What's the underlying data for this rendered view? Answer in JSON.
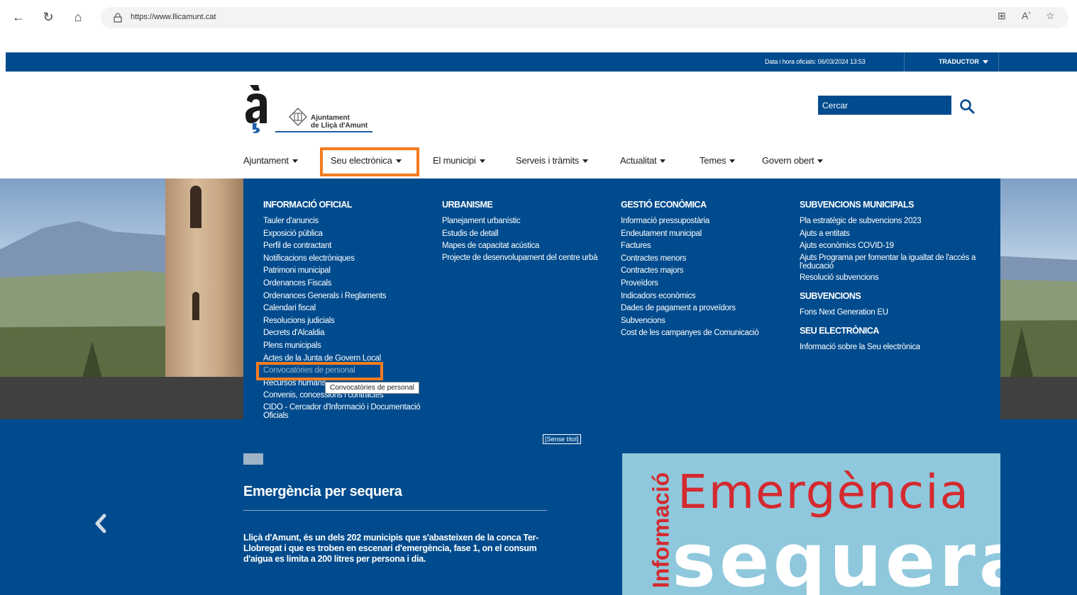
{
  "browser": {
    "url": "https://www.llicamunt.cat"
  },
  "topbar": {
    "date_text": "Data i hora oficials: 06/03/2024 13:53",
    "translator_label": "TRADUCTOR"
  },
  "logo": {
    "line1": "Ajuntament",
    "line2": "de Lliçà d'Amunt"
  },
  "search": {
    "placeholder": "Cercar"
  },
  "nav": {
    "items": [
      {
        "label": "Ajuntament"
      },
      {
        "label": "Seu electrònica"
      },
      {
        "label": "El municipi"
      },
      {
        "label": "Serveis i tràmits"
      },
      {
        "label": "Actualitat"
      },
      {
        "label": "Temes"
      },
      {
        "label": "Govern obert"
      }
    ]
  },
  "megamenu": {
    "col1": {
      "heading": "INFORMACIÓ OFICIAL",
      "items": [
        "Tauler d'anuncis",
        "Exposició pública",
        "Perfil de contractant",
        "Notificacions electròniques",
        "Patrimoni municipal",
        "Ordenances Fiscals",
        "Ordenances Generals i Reglaments",
        "Calendari fiscal",
        "Resolucions judicials",
        "Decrets d'Alcaldia",
        "Plens municipals",
        "Actes de la Junta de Govern Local",
        "Convocatòries de personal",
        "Recursos humans",
        "Convenis, concessions i contractes",
        "CIDO - Cercador d'Informació i Documentació Oficials"
      ]
    },
    "col2": {
      "heading": "URBANISME",
      "items": [
        "Planejament urbanístic",
        "Estudis de detall",
        "Mapes de capacitat acústica",
        "Projecte de desenvolupament del centre urbà"
      ]
    },
    "col3": {
      "heading": "GESTIÓ ECONÒMICA",
      "items": [
        "Informació pressupostària",
        "Endeutament municipal",
        "Factures",
        "Contractes menors",
        "Contractes majors",
        "Proveïdors",
        "Indicadors econòmics",
        "Dades de pagament a proveïdors",
        "Subvencions",
        "Cost de les campanyes de Comunicació"
      ]
    },
    "col4": {
      "heading": "SUBVENCIONS MUNICIPALS",
      "items": [
        "Pla estratègic de subvencions 2023",
        "Ajuts a entitats",
        "Ajuts econòmics COVID-19",
        "Ajuts Programa per fomentar la igualtat de l'accés a l'educació",
        "Resolució subvencions"
      ],
      "heading2": "SUBVENCIONS",
      "items2": [
        "Fons Next Generation EU"
      ],
      "heading3": "SEU ELECTRÒNICA",
      "items3": [
        "Informació sobre la Seu electrònica"
      ]
    },
    "footer_label": "[Sense títol]",
    "tooltip": "Convocatòries de personal"
  },
  "slide": {
    "title": "Emergència per sequera",
    "description": "Lliçà d'Amunt, és un dels 202 municipis que s'abasteixen de la conca Ter-Llobregat i que es troben en escenari d'emergència, fase 1, on el consum d'aigua es limita a 200 litres per persona i dia.",
    "promo_side": "Informació",
    "promo_line1": "Emergència",
    "promo_line2": "sequera"
  },
  "colors": {
    "primary_blue": "#004b8d",
    "highlight_orange": "#f47c20",
    "promo_red": "#d42a2f"
  }
}
